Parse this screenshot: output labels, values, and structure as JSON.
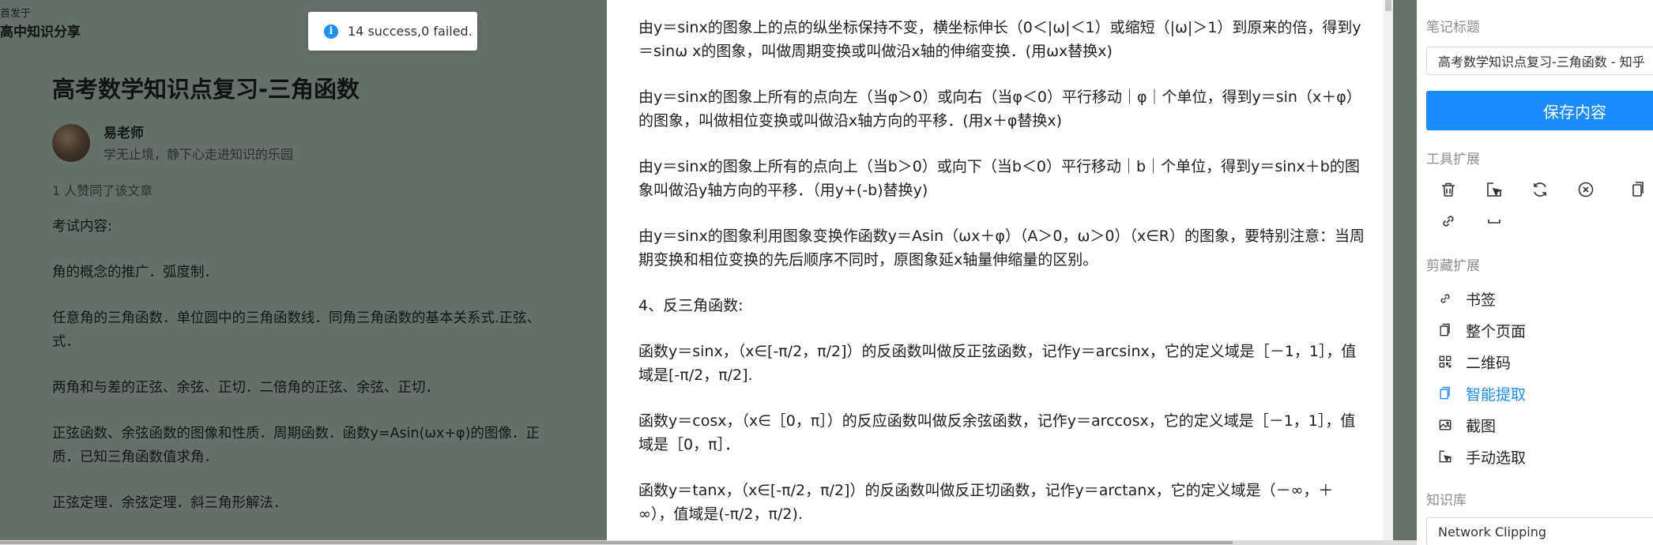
{
  "left": {
    "publish_prefix": "首发于",
    "column_name": "高中知识分享",
    "article_title": "高考数学知识点复习-三角函数",
    "author_name": "易老师",
    "author_motto": "学无止境，静下心走进知识的乐园",
    "likes_text": "1 人赞同了该文章",
    "paragraphs": [
      "考试内容:",
      "角的概念的推广．弧度制．",
      "任意角的三角函数．单位圆中的三角函数线．同角三角函数的基本关系式.正弦、",
      "式．",
      "两角和与差的正弦、余弦、正切．二倍角的正弦、余弦、正切．",
      "正弦函数、余弦函数的图像和性质．周期函数．函数y=Asin(ωx+φ)的图像．正",
      "质．已知三角函数值求角．",
      "正弦定理．余弦定理．斜三角形解法．"
    ]
  },
  "toast": {
    "message": "14 success,0 failed.",
    "icon": "info-icon"
  },
  "content": {
    "paragraphs": [
      "由y＝sinx的图象上的点的纵坐标保持不变，横坐标伸长（0＜|ω|＜1）或缩短（|ω|＞1）到原来的倍，得到y＝sinω x的图象，叫做周期变换或叫做沿x轴的伸缩变换．(用ωx替换x)",
      "由y＝sinx的图象上所有的点向左（当φ＞0）或向右（当φ＜0）平行移动｜φ｜个单位，得到y＝sin（x＋φ）的图象，叫做相位变换或叫做沿x轴方向的平移．(用x＋φ替换x)",
      "由y＝sinx的图象上所有的点向上（当b＞0）或向下（当b＜0）平行移动｜b｜个单位，得到y＝sinx＋b的图象叫做沿y轴方向的平移．（用y+(-b)替换y)",
      "由y＝sinx的图象利用图象变换作函数y＝Asin（ωx＋φ）（A＞0，ω＞0）（x∈R）的图象，要特别注意：当周期变换和相位变换的先后顺序不同时，原图象延x轴量伸缩量的区别。",
      "4、反三角函数:",
      "函数y＝sinx，（x∈[-π/2，π/2]）的反函数叫做反正弦函数，记作y＝arcsinx，它的定义域是［－1，1］，值域是[-π/2，π/2].",
      "函数y＝cosx，（x∈［0，π］）的反应函数叫做反余弦函数，记作y＝arccosx，它的定义域是［－1，1］，值域是［0，π］．",
      "函数y＝tanx，（x∈[-π/2，π/2]）的反函数叫做反正切函数，记作y＝arctanx，它的定义域是（－∞，＋∞），值域是(-π/2，π/2)."
    ]
  },
  "sidebar": {
    "note_title_label": "笔记标题",
    "note_title_value": "高考数学知识点复习-三角函数 - 知乎",
    "save_label": "保存内容",
    "tools_label": "工具扩展",
    "tool_icons": [
      "trash-icon",
      "select-area-icon",
      "refresh-icon",
      "close-circle-icon",
      "copy-icon",
      "link-icon",
      "space-icon"
    ],
    "clip_label": "剪藏扩展",
    "clip_items": [
      {
        "label": "书签",
        "icon": "link-icon"
      },
      {
        "label": "整个页面",
        "icon": "document-icon"
      },
      {
        "label": "二维码",
        "icon": "qrcode-icon"
      },
      {
        "label": "智能提取",
        "icon": "smart-extract-icon",
        "active": true
      },
      {
        "label": "截图",
        "icon": "image-icon"
      },
      {
        "label": "手动选取",
        "icon": "manual-select-icon"
      }
    ],
    "kb_label": "知识库",
    "kb_value": "Network Clipping"
  },
  "colors": {
    "accent": "#1a8cff",
    "overlay": "#66716a"
  }
}
